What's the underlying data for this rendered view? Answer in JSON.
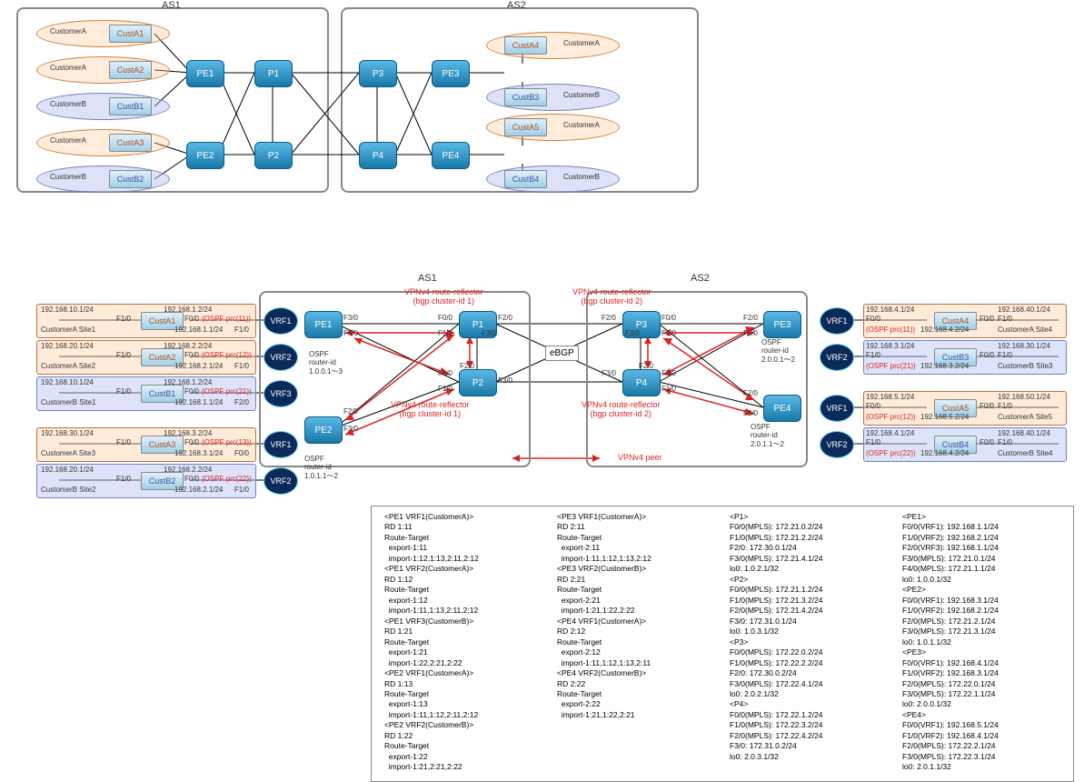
{
  "top": {
    "as1": "AS1",
    "as2": "AS2",
    "routers": [
      "PE1",
      "P1",
      "PE2",
      "P2",
      "P3",
      "PE3",
      "P4",
      "PE4"
    ],
    "custA": "CustomerA",
    "custB": "CustomerB",
    "c": {
      "a1": "CustA1",
      "a2": "CustA2",
      "b1": "CustB1",
      "a3": "CustA3",
      "b2": "CustB2",
      "a4": "CustA4",
      "b3": "CustB3",
      "a5": "CustA5",
      "b4": "CustB4"
    }
  },
  "mid": {
    "as1": "AS1",
    "as2": "AS2",
    "ebgp": "eBGP",
    "rr1": "VPNv4 route-reflector\n(bgp cluster-id 1)",
    "rr2": "VPNv4 route-reflector\n(bgp cluster-id 2)",
    "peer": "VPNv4 peer",
    "ospf1": "OSPF\nrouter-id\n1.0.0.1～3",
    "ospf2": "OSPF\nrouter-id\n1.0.1.1～2",
    "ospf3": "OSPF\nrouter-id\n2.0.0.1～2",
    "ospf4": "OSPF\nrouter-id\n2.0.1.1～2",
    "sites": {
      "a1": {
        "name": "CustomerA Site1",
        "ip": "192.168.10.1/24",
        "if": "F1/0",
        "peip": "192.168.1.2/24",
        "peif": "F0/0",
        "ospf": "(OSPF prc(11))",
        "peip2": "192.168.1.1/24",
        "peif2": "F1/0"
      },
      "a2": {
        "name": "CustomerA Site2",
        "ip": "192.168.20.1/24",
        "if": "F1/0",
        "peip": "192.168.2.2/24",
        "peif": "F0/0",
        "ospf": "(OSPF prc(12))",
        "peip2": "192.168.2.1/24",
        "peif2": "F1/0"
      },
      "b1": {
        "name": "CustomerB Site1",
        "ip": "192.168.10.1/24",
        "if": "F1/0",
        "peip": "192.168.1.2/24",
        "peif": "F0/0",
        "ospf": "(OSPF prc(21))",
        "peip2": "192.168.1.1/24",
        "peif2": "F2/0"
      },
      "a3": {
        "name": "CustomerA Site3",
        "ip": "192.168.30.1/24",
        "if": "F1/0",
        "peip": "192.168.3.2/24",
        "peif": "F0/0",
        "ospf": "(OSPF prc(13))",
        "peip2": "192.168.3.1/24",
        "peif2": "F0/0"
      },
      "b2": {
        "name": "CustomerB Site2",
        "ip": "192.168.20.1/24",
        "if": "F1/0",
        "peip": "192.168.2.2/24",
        "peif": "F0/0",
        "ospf": "(OSPF prc(22))",
        "peip2": "192.168.2.1/24",
        "peif2": "F1/0"
      },
      "a4": {
        "name": "CustomerA Site4",
        "ip": "192.168.40.1/24",
        "if": "F1/0",
        "peip": "192.168.4.1/24",
        "peif": "F0/0",
        "ospf": "(OSPF prc(11))",
        "peip2": "192.168.4.2/24",
        "peif2": "F0/0"
      },
      "b3": {
        "name": "CustomerB Site3",
        "ip": "192.168.30.1/24",
        "if": "F1/0",
        "peip": "192.168.3.1/24",
        "peif": "F1/0",
        "ospf": "(OSPF prc(21))",
        "peip2": "192.168.3.2/24",
        "peif2": "F0/0"
      },
      "a5": {
        "name": "CustomerA Site5",
        "ip": "192.168.50.1/24",
        "if": "F1/0",
        "peip": "192.168.5.1/24",
        "peif": "F0/0",
        "ospf": "(OSPF prc(12))",
        "peip2": "192.168.5.2/24",
        "peif2": "F0/0"
      },
      "b4": {
        "name": "CustomerB Site4",
        "ip": "192.168.40.1/24",
        "if": "F1/0",
        "peip": "192.168.4.1/24",
        "peif": "F1/0",
        "ospf": "(OSPF prc(22))",
        "peip2": "192.168.4.2/24",
        "peif2": "F0/0"
      }
    },
    "ifs": {
      "f00": "F0/0",
      "f10": "F1/0",
      "f20": "F2/0",
      "f30": "F3/0",
      "f40": "F4/0"
    }
  },
  "cfg": {
    "c1": "<PE1 VRF1(CustomerA)>\nRD 1:11\nRoute-Target\n  export-1:11\n  import-1:12,1:13,2:11,2:12\n<PE1 VRF2(CustomerA)>\nRD 1:12\nRoute-Target\n  export-1:12\n  import-1:11,1:13,2:11,2:12\n<PE1 VRF3(CustomerB)>\nRD 1:21\nRoute-Target\n  export-1:21\n  import-1:22,2:21,2:22\n<PE2 VRF1(CustomerA)>\nRD 1:13\nRoute-Target\n  export-1:13\n  import-1:11,1:12,2:11,2:12\n<PE2 VRF2(CustomerB)>\nRD 1:22\nRoute-Target\n  export-1:22\n  import-1:21,2:21,2:22",
    "c2": "<PE3 VRF1(CustomerA)>\nRD 2:11\nRoute-Target\n  export-2:11\n  import-1:11,1:12,1:13,2:12\n<PE3 VRF2(CustomerB)>\nRD 2:21\nRoute-Target\n  export-2:21\n  import-1:21,1:22,2:22\n<PE4 VRF1(CustomerA)>\nRD 2:12\nRoute-Target\n  export-2:12\n  import-1:11,1:12,1:13,2:11\n<PE4 VRF2(CustomerB)>\nRD 2:22\nRoute-Target\n  export-2:22\n  import-1:21,1:22,2:21",
    "c3": "<P1>\nF0/0(MPLS): 172.21.0.2/24\nF1/0(MPLS): 172.21.2.2/24\nF2/0: 172.30.0.1/24\nF3/0(MPLS): 172.21.4.1/24\nlo0: 1.0.2.1/32\n<P2>\nF0/0(MPLS): 172.21.1.2/24\nF1/0(MPLS): 172.21.3.2/24\nF2/0(MPLS): 172.21.4.2/24\nF3/0: 172.31.0.1/24\nlo0: 1.0.3.1/32\n<P3>\nF0/0(MPLS): 172.22.0.2/24\nF1/0(MPLS): 172.22.2.2/24\nF2/0: 172.30.0.2/24\nF3/0(MPLS): 172.22.4.1/24\nlo0: 2.0.2.1/32\n<P4>\nF0/0(MPLS): 172.22.1.2/24\nF1/0(MPLS): 172.22.3.2/24\nF2/0(MPLS): 172.22.4.2/24\nF3/0: 172.31.0.2/24\nlo0: 2.0.3.1/32",
    "c4": "<PE1>\nF0/0(VRF1): 192.168.1.1/24\nF1/0(VRF2): 192.168.2.1/24\nF2/0(VRF3): 192.168.1.1/24\nF3/0(MPLS): 172.21.0.1/24\nF4/0(MPLS): 172.21.1.1/24\nlo0: 1.0.0.1/32\n<PE2>\nF0/0(VRF1): 192.168.3.1/24\nF1/0(VRF2): 192.168.2.1/24\nF2/0(MPLS): 172.21.2.1/24\nF3/0(MPLS): 172.21.3.1/24\nlo0: 1.0.1.1/32\n<PE3>\nF0/0(VRF1): 192.168.4.1/24\nF1/0(VRF2): 192.168.3.1/24\nF2/0(MPLS): 172.22.0.1/24\nF3/0(MPLS): 172.22.1.1/24\nlo0: 2.0.0.1/32\n<PE4>\nF0/0(VRF1): 192.168.5.1/24\nF1/0(VRF2): 192.168.4.1/24\nF2/0(MPLS): 172.22.2.1/24\nF3/0(MPLS): 172.22.3.1/24\nlo0: 2.0.1.1/32"
  },
  "vrfLabels": {
    "v1": "VRF1",
    "v2": "VRF2",
    "v3": "VRF3"
  }
}
